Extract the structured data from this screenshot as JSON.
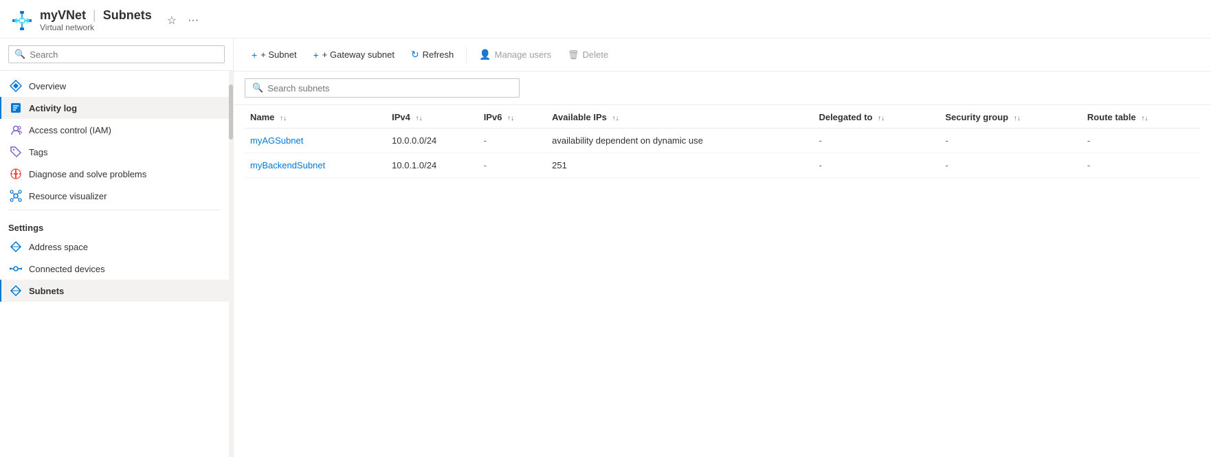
{
  "header": {
    "resource_name": "myVNet",
    "separator": "|",
    "page_title": "Subnets",
    "subtitle": "Virtual network",
    "star_label": "☆",
    "more_label": "···"
  },
  "sidebar": {
    "search_placeholder": "Search",
    "collapse_label": "«",
    "nav_items": [
      {
        "id": "overview",
        "label": "Overview",
        "icon": "vnet"
      },
      {
        "id": "activity-log",
        "label": "Activity log",
        "icon": "log",
        "active": false
      },
      {
        "id": "access-control",
        "label": "Access control (IAM)",
        "icon": "iam"
      },
      {
        "id": "tags",
        "label": "Tags",
        "icon": "tag"
      },
      {
        "id": "diagnose",
        "label": "Diagnose and solve problems",
        "icon": "wrench"
      },
      {
        "id": "resource-visualizer",
        "label": "Resource visualizer",
        "icon": "visualizer"
      }
    ],
    "settings_header": "Settings",
    "settings_items": [
      {
        "id": "address-space",
        "label": "Address space",
        "icon": "vnet"
      },
      {
        "id": "connected-devices",
        "label": "Connected devices",
        "icon": "plug"
      },
      {
        "id": "subnets",
        "label": "Subnets",
        "icon": "vnet",
        "active": true
      }
    ]
  },
  "toolbar": {
    "add_subnet_label": "+ Subnet",
    "add_gateway_label": "+ Gateway subnet",
    "refresh_label": "Refresh",
    "manage_users_label": "Manage users",
    "delete_label": "Delete"
  },
  "content_search": {
    "placeholder": "Search subnets"
  },
  "table": {
    "columns": [
      {
        "id": "name",
        "label": "Name"
      },
      {
        "id": "ipv4",
        "label": "IPv4"
      },
      {
        "id": "ipv6",
        "label": "IPv6"
      },
      {
        "id": "available_ips",
        "label": "Available IPs"
      },
      {
        "id": "delegated_to",
        "label": "Delegated to"
      },
      {
        "id": "security_group",
        "label": "Security group"
      },
      {
        "id": "route_table",
        "label": "Route table"
      }
    ],
    "rows": [
      {
        "name": "myAGSubnet",
        "ipv4": "10.0.0.0/24",
        "ipv6": "-",
        "available_ips": "availability dependent on dynamic use",
        "delegated_to": "-",
        "security_group": "-",
        "route_table": "-"
      },
      {
        "name": "myBackendSubnet",
        "ipv4": "10.0.1.0/24",
        "ipv6": "-",
        "available_ips": "251",
        "delegated_to": "-",
        "security_group": "-",
        "route_table": "-"
      }
    ]
  }
}
